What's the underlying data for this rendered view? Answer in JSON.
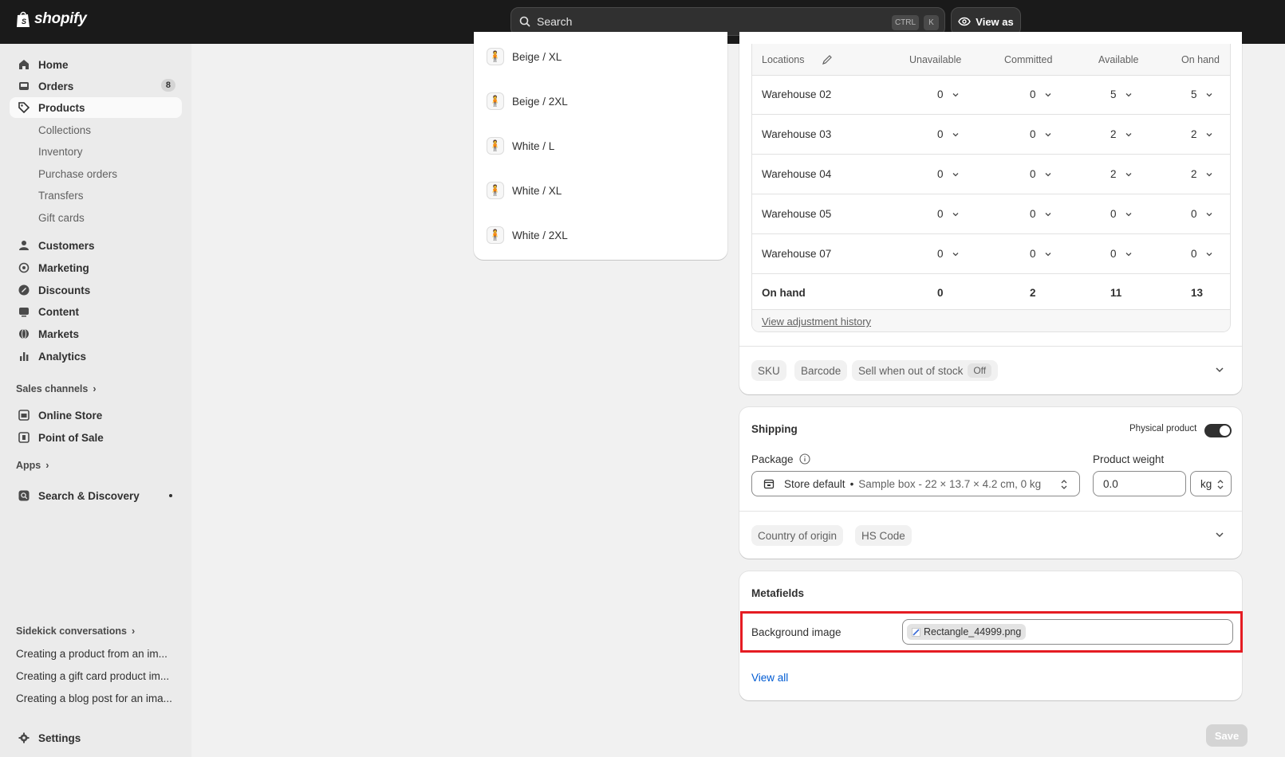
{
  "topbar": {
    "brand": "shopify",
    "search_placeholder": "Search",
    "shortcut_ctrl": "CTRL",
    "shortcut_k": "K",
    "view_as": "View as"
  },
  "sidebar": {
    "items": [
      {
        "label": "Home",
        "icon": "home-icon"
      },
      {
        "label": "Orders",
        "icon": "inbox-icon",
        "badge": "8"
      },
      {
        "label": "Products",
        "icon": "tag-icon"
      }
    ],
    "products_sub": [
      "Collections",
      "Inventory",
      "Purchase orders",
      "Transfers",
      "Gift cards"
    ],
    "items2": [
      {
        "label": "Customers",
        "icon": "person-icon"
      },
      {
        "label": "Marketing",
        "icon": "target-icon"
      },
      {
        "label": "Discounts",
        "icon": "discount-icon"
      },
      {
        "label": "Content",
        "icon": "content-icon"
      },
      {
        "label": "Markets",
        "icon": "globe-icon"
      },
      {
        "label": "Analytics",
        "icon": "chart-icon"
      }
    ],
    "sales_channels": "Sales channels",
    "channels": [
      {
        "label": "Online Store",
        "icon": "store-icon"
      },
      {
        "label": "Point of Sale",
        "icon": "pos-icon"
      }
    ],
    "apps": "Apps",
    "search_discovery": "Search & Discovery",
    "sidekick": "Sidekick conversations",
    "conversations": [
      "Creating a product from an im...",
      "Creating a gift card product im...",
      "Creating a blog post for an ima..."
    ],
    "settings": "Settings"
  },
  "variants": [
    "Beige / XL",
    "Beige / 2XL",
    "White / L",
    "White / XL",
    "White / 2XL"
  ],
  "inventory": {
    "headers": {
      "locations": "Locations",
      "unavailable": "Unavailable",
      "committed": "Committed",
      "available": "Available",
      "on_hand": "On hand"
    },
    "rows": [
      {
        "location": "Warehouse 02",
        "unavailable": "0",
        "committed": "0",
        "available": "5",
        "on_hand": "5"
      },
      {
        "location": "Warehouse 03",
        "unavailable": "0",
        "committed": "0",
        "available": "2",
        "on_hand": "2"
      },
      {
        "location": "Warehouse 04",
        "unavailable": "0",
        "committed": "0",
        "available": "2",
        "on_hand": "2"
      },
      {
        "location": "Warehouse 05",
        "unavailable": "0",
        "committed": "0",
        "available": "0",
        "on_hand": "0"
      },
      {
        "location": "Warehouse 07",
        "unavailable": "0",
        "committed": "0",
        "available": "0",
        "on_hand": "0"
      }
    ],
    "total": {
      "label": "On hand",
      "unavailable": "0",
      "committed": "2",
      "available": "11",
      "on_hand": "13"
    },
    "history_link": "View adjustment history"
  },
  "chips": {
    "sku": "SKU",
    "barcode": "Barcode",
    "sell_oos": "Sell when out of stock",
    "sell_oos_state": "Off"
  },
  "shipping": {
    "title": "Shipping",
    "physical_label": "Physical product",
    "package_label": "Package",
    "package_name": "Store default",
    "package_detail": "Sample box - 22 × 13.7 × 4.2 cm, 0 kg",
    "weight_label": "Product weight",
    "weight_value": "0.0",
    "weight_unit": "kg",
    "country_chip": "Country of origin",
    "hs_chip": "HS Code"
  },
  "metafields": {
    "title": "Metafields",
    "field_label": "Background image",
    "file_name": "Rectangle_44999.png",
    "view_all": "View all"
  },
  "save_label": "Save",
  "colors": {
    "topbar": "#1a1a1a",
    "highlight": "#e51c23",
    "link": "#005bd3"
  }
}
